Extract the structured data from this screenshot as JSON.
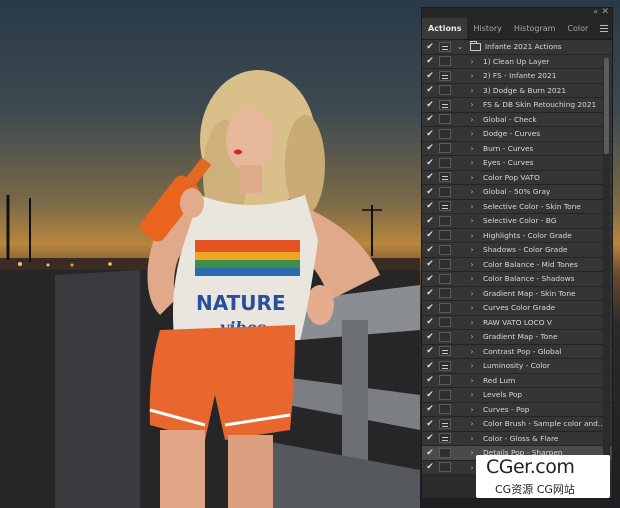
{
  "panel": {
    "tabs": [
      {
        "label": "Actions",
        "active": true
      },
      {
        "label": "History",
        "active": false
      },
      {
        "label": "Histogram",
        "active": false
      },
      {
        "label": "Color",
        "active": false
      }
    ],
    "set_name": "Infante 2021 Actions",
    "actions": [
      {
        "label": "1) Clean Up Layer",
        "dialog": false
      },
      {
        "label": "2) FS - Infante 2021",
        "dialog": true
      },
      {
        "label": "3) Dodge & Burn 2021",
        "dialog": false
      },
      {
        "label": "FS & DB Skin Retouching 2021",
        "dialog": true
      },
      {
        "label": "Global - Check",
        "dialog": false
      },
      {
        "label": "Dodge - Curves",
        "dialog": false
      },
      {
        "label": "Burn - Curves",
        "dialog": false
      },
      {
        "label": "Eyes - Curves",
        "dialog": false
      },
      {
        "label": "Color Pop VATO",
        "dialog": true
      },
      {
        "label": "Global - 50% Gray",
        "dialog": false
      },
      {
        "label": "Selective Color - Skin Tone",
        "dialog": true
      },
      {
        "label": "Selective Color - BG",
        "dialog": false
      },
      {
        "label": "Highlights - Color Grade",
        "dialog": false
      },
      {
        "label": "Shadows - Color Grade",
        "dialog": false
      },
      {
        "label": "Color Balance - Mid Tones",
        "dialog": false
      },
      {
        "label": "Color Balance - Shadows",
        "dialog": false
      },
      {
        "label": "Gradient Map - Skin Tone",
        "dialog": false
      },
      {
        "label": "Curves Color Grade",
        "dialog": false
      },
      {
        "label": "RAW VATO LOCO V",
        "dialog": false
      },
      {
        "label": "Gradient Map - Tone",
        "dialog": false
      },
      {
        "label": "Contrast Pop - Global",
        "dialog": true
      },
      {
        "label": "Luminosity - Color",
        "dialog": true
      },
      {
        "label": "Red Lum",
        "dialog": false
      },
      {
        "label": "Levels Pop",
        "dialog": false
      },
      {
        "label": "Curves - Pop",
        "dialog": false
      },
      {
        "label": "Color Brush - Sample color and i...",
        "dialog": true
      },
      {
        "label": "Color - Gloss & Flare",
        "dialog": true
      },
      {
        "label": "Details Pop - Sharpen",
        "dialog": false,
        "selected": true
      },
      {
        "label": "",
        "dialog": false
      }
    ]
  },
  "photo": {
    "shirt_text_line1": "NATURE",
    "shirt_text_line2": "vibes"
  },
  "watermark": {
    "top": "CGer.com",
    "bottom": "CG资源  CG网站"
  }
}
